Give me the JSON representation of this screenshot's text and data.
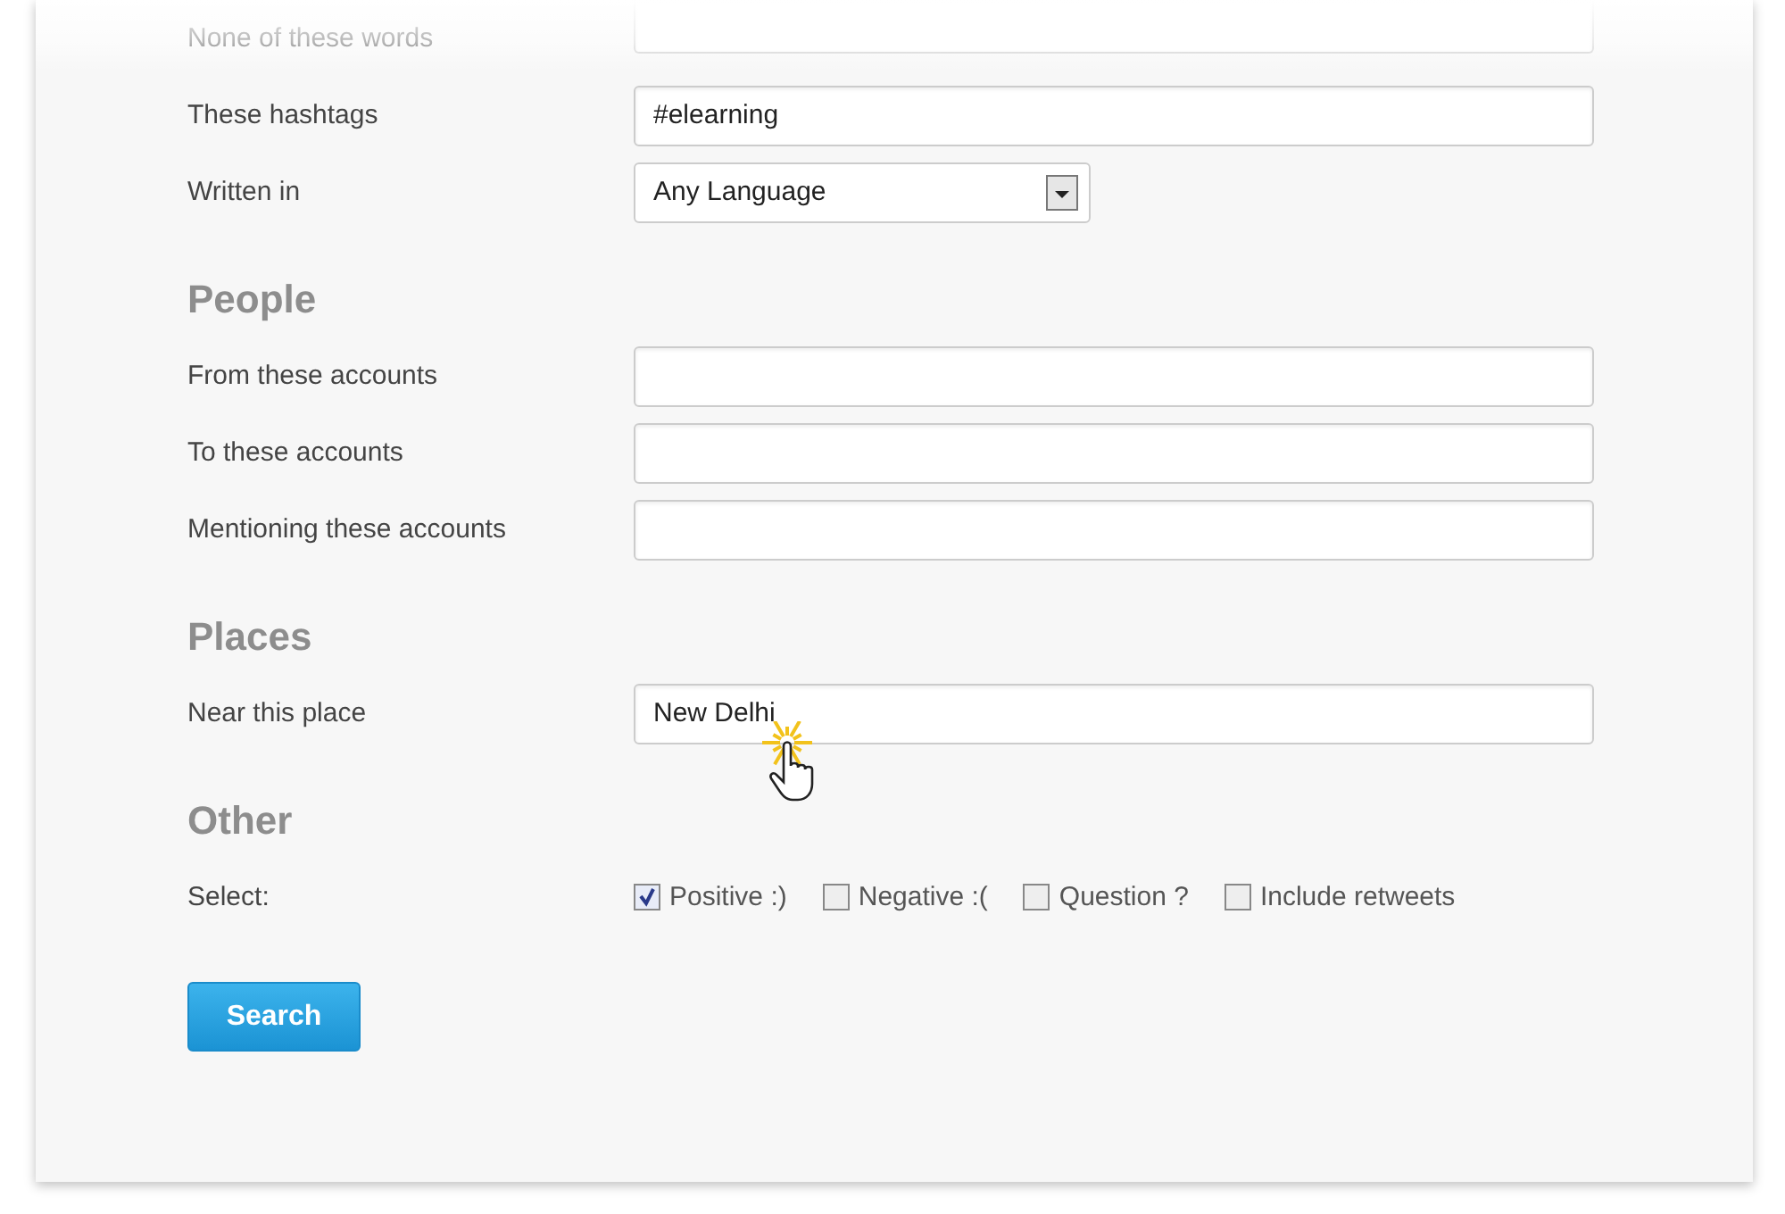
{
  "sections": [
    {
      "rows": [
        {
          "kind": "text",
          "label": "None of these words"
        },
        {
          "kind": "text",
          "label": "These hashtags",
          "value": "#elearning"
        },
        {
          "kind": "select",
          "label": "Written in",
          "value": "Any Language"
        }
      ]
    },
    {
      "heading": "People",
      "rows": [
        {
          "kind": "text",
          "label": "From these accounts"
        },
        {
          "kind": "text",
          "label": "To these accounts"
        },
        {
          "kind": "text",
          "label": "Mentioning these accounts"
        }
      ]
    },
    {
      "heading": "Places",
      "rows": [
        {
          "kind": "text",
          "label": "Near this place",
          "value": "New Delhi",
          "cursor": true
        }
      ]
    },
    {
      "heading": "Other",
      "rows": [
        {
          "kind": "checks",
          "label": "Select:",
          "options": [
            {
              "label": "Positive :)",
              "checked": true
            },
            {
              "label": "Negative :(",
              "checked": false
            },
            {
              "label": "Question ?",
              "checked": false
            },
            {
              "label": "Include retweets",
              "checked": false
            }
          ]
        }
      ]
    }
  ],
  "search_button": "Search"
}
